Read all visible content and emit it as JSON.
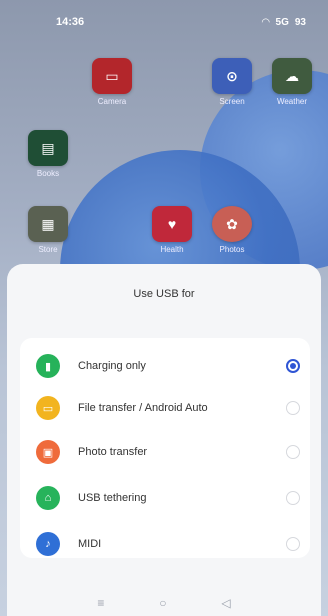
{
  "status_bar": {
    "time": "14:36",
    "signal_text": "5G",
    "battery": "93"
  },
  "home_apps": [
    {
      "name": "Camera",
      "color": "#b3262b",
      "glyph": "▭"
    },
    {
      "name": "Screen",
      "color": "#3d5fb8",
      "glyph": "⊙"
    },
    {
      "name": "Weather",
      "color": "#405b3f",
      "glyph": "☁"
    },
    {
      "name": "Books",
      "color": "#1f4e35",
      "glyph": "▤"
    },
    {
      "name": "Store",
      "color": "#5a6152",
      "glyph": "▦"
    },
    {
      "name": "Health",
      "color": "#c0283a",
      "glyph": "♥"
    },
    {
      "name": "Photos",
      "color": "#c85f55",
      "glyph": "✿"
    }
  ],
  "sheet": {
    "title": "Use USB for",
    "options": [
      {
        "label": "Charging only",
        "icon": "battery-icon",
        "color": "#26b25a",
        "glyph": "▮",
        "selected": true
      },
      {
        "label": "File transfer / Android Auto",
        "icon": "folder-icon",
        "color": "#f2b41f",
        "glyph": "▭",
        "selected": false
      },
      {
        "label": "Photo transfer",
        "icon": "photo-icon",
        "color": "#ef6b3b",
        "glyph": "▣",
        "selected": false
      },
      {
        "label": "USB tethering",
        "icon": "tethering-icon",
        "color": "#27b35b",
        "glyph": "⌂",
        "selected": false
      },
      {
        "label": "MIDI",
        "icon": "midi-icon",
        "color": "#2f6fd6",
        "glyph": "♪",
        "selected": false
      }
    ]
  },
  "nav": {
    "recents": "≡",
    "home": "○",
    "back": "◁"
  }
}
